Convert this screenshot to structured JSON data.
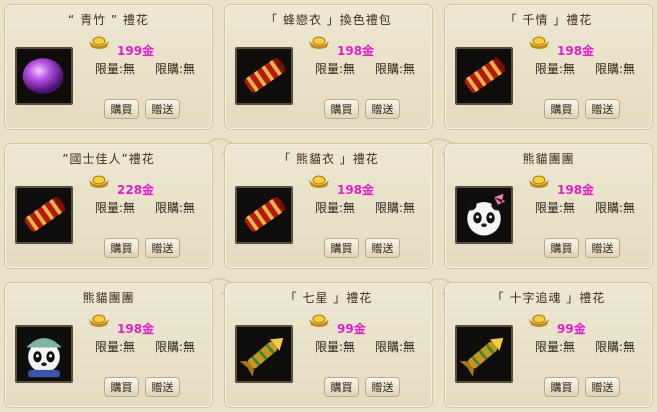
{
  "currency_icon": "gold-ingot-icon",
  "colors": {
    "price": "#e020c8",
    "card_bg": "#eee7d2",
    "page_bg": "#e9e1c8"
  },
  "items": [
    {
      "title": "“ 青竹 ” 禮花",
      "price": "199金",
      "limit_label_a": "限量:無",
      "limit_label_b": "限購:無",
      "buy": "購買",
      "gift": "贈送",
      "icon": "purple-gem-icon"
    },
    {
      "title": "「 蜂戀衣 」換色禮包",
      "price": "198金",
      "limit_label_a": "限量:無",
      "limit_label_b": "限購:無",
      "buy": "購買",
      "gift": "贈送",
      "icon": "firework-tube-icon"
    },
    {
      "title": "「 千情 」禮花",
      "price": "198金",
      "limit_label_a": "限量:無",
      "limit_label_b": "限購:無",
      "buy": "購買",
      "gift": "贈送",
      "icon": "firework-tube-icon"
    },
    {
      "title": "”國士佳人”禮花",
      "price": "228金",
      "limit_label_a": "限量:無",
      "limit_label_b": "限購:無",
      "buy": "購買",
      "gift": "贈送",
      "icon": "firework-tube-icon"
    },
    {
      "title": "「 熊貓衣 」禮花",
      "price": "198金",
      "limit_label_a": "限量:無",
      "limit_label_b": "限購:無",
      "buy": "購買",
      "gift": "贈送",
      "icon": "firework-tube-icon"
    },
    {
      "title": "熊貓團團",
      "price": "198金",
      "limit_label_a": "限量:無",
      "limit_label_b": "限購:無",
      "buy": "購買",
      "gift": "贈送",
      "icon": "panda-pink-bow-icon"
    },
    {
      "title": "熊貓團團",
      "price": "198金",
      "limit_label_a": "限量:無",
      "limit_label_b": "限購:無",
      "buy": "購買",
      "gift": "贈送",
      "icon": "panda-green-hat-icon"
    },
    {
      "title": "「 七星 」禮花",
      "price": "99金",
      "limit_label_a": "限量:無",
      "limit_label_b": "限購:無",
      "buy": "購買",
      "gift": "贈送",
      "icon": "golden-rocket-icon"
    },
    {
      "title": "「 十字追魂 」禮花",
      "price": "99金",
      "limit_label_a": "限量:無",
      "limit_label_b": "限購:無",
      "buy": "購買",
      "gift": "贈送",
      "icon": "golden-rocket-icon"
    }
  ]
}
